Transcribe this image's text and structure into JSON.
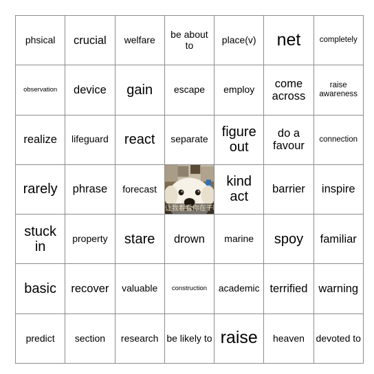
{
  "card": {
    "type": "bingo-card",
    "columns": 7,
    "rows": 7,
    "border_color": "#8c8c8c",
    "background_color": "#ffffff",
    "text_color": "#000000",
    "cells": [
      [
        {
          "text": "phsical",
          "size": "m"
        },
        {
          "text": "crucial",
          "size": "l"
        },
        {
          "text": "welfare",
          "size": "m"
        },
        {
          "text": "be about to",
          "size": "m"
        },
        {
          "text": "place(v)",
          "size": "m"
        },
        {
          "text": "net",
          "size": "xxl"
        },
        {
          "text": "completely",
          "size": "s"
        }
      ],
      [
        {
          "text": "observation",
          "size": "xs"
        },
        {
          "text": "device",
          "size": "l"
        },
        {
          "text": "gain",
          "size": "xl"
        },
        {
          "text": "escape",
          "size": "m"
        },
        {
          "text": "employ",
          "size": "m"
        },
        {
          "text": "come across",
          "size": "l"
        },
        {
          "text": "raise awareness",
          "size": "s"
        }
      ],
      [
        {
          "text": "realize",
          "size": "l"
        },
        {
          "text": "lifeguard",
          "size": "m"
        },
        {
          "text": "react",
          "size": "xl"
        },
        {
          "text": "separate",
          "size": "m"
        },
        {
          "text": "figure out",
          "size": "xl"
        },
        {
          "text": "do a favour",
          "size": "l"
        },
        {
          "text": "connection",
          "size": "s"
        }
      ],
      [
        {
          "text": "rarely",
          "size": "xl"
        },
        {
          "text": "phrase",
          "size": "l"
        },
        {
          "text": "forecast",
          "size": "m"
        },
        {
          "type": "image",
          "caption": "让我看看你在干嘛",
          "alt": "white fluffy dog close-up photo"
        },
        {
          "text": "kind act",
          "size": "xl"
        },
        {
          "text": "barrier",
          "size": "l"
        },
        {
          "text": "inspire",
          "size": "l"
        }
      ],
      [
        {
          "text": "stuck in",
          "size": "xl"
        },
        {
          "text": "property",
          "size": "m"
        },
        {
          "text": "stare",
          "size": "xl"
        },
        {
          "text": "drown",
          "size": "l"
        },
        {
          "text": "marine",
          "size": "m"
        },
        {
          "text": "spoy",
          "size": "xl"
        },
        {
          "text": "familiar",
          "size": "l"
        }
      ],
      [
        {
          "text": "basic",
          "size": "xl"
        },
        {
          "text": "recover",
          "size": "l"
        },
        {
          "text": "valuable",
          "size": "m"
        },
        {
          "text": "construction",
          "size": "xs"
        },
        {
          "text": "academic",
          "size": "m"
        },
        {
          "text": "terrified",
          "size": "l"
        },
        {
          "text": "warning",
          "size": "l"
        }
      ],
      [
        {
          "text": "predict",
          "size": "m"
        },
        {
          "text": "section",
          "size": "m"
        },
        {
          "text": "research",
          "size": "m"
        },
        {
          "text": "be likely to",
          "size": "m"
        },
        {
          "text": "raise",
          "size": "xxl"
        },
        {
          "text": "heaven",
          "size": "m"
        },
        {
          "text": "devoted to",
          "size": "m"
        }
      ]
    ]
  }
}
